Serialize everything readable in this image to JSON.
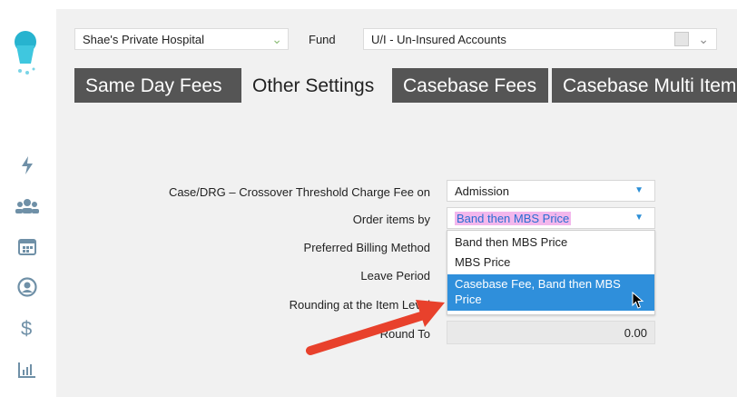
{
  "header": {
    "hospital": "Shae's Private Hospital",
    "fund_label": "Fund",
    "fund_value": "U/I - Un-Insured Accounts"
  },
  "tabs": [
    {
      "label": "Same Day Fees",
      "active": false
    },
    {
      "label": "Other Settings",
      "active": true
    },
    {
      "label": "Casebase Fees",
      "active": false
    },
    {
      "label": "Casebase Multi Item",
      "active": false
    }
  ],
  "settings": {
    "crossover_label": "Case/DRG – Crossover Threshold Charge Fee on",
    "crossover_value": "Admission",
    "order_items_label": "Order items by",
    "order_items_value": "Band then MBS Price",
    "preferred_billing_label": "Preferred Billing Method",
    "leave_period_label": "Leave Period",
    "rounding_item_label": "Rounding at the Item Level",
    "round_to_label": "Round To",
    "round_to_value": "0.00"
  },
  "order_items_options": [
    "Band then MBS Price",
    "MBS Price",
    "Casebase Fee, Band then MBS Price"
  ],
  "colors": {
    "tab_inactive": "#555555",
    "accent_blue": "#2f8fdb",
    "highlight_pink": "#f3b7ec",
    "arrow_red": "#e8412c",
    "nav_icon": "#6f90a7"
  },
  "nav_icons": [
    "bolt-icon",
    "users-icon",
    "calendar-icon",
    "user-circle-icon",
    "dollar-icon",
    "chart-icon"
  ]
}
